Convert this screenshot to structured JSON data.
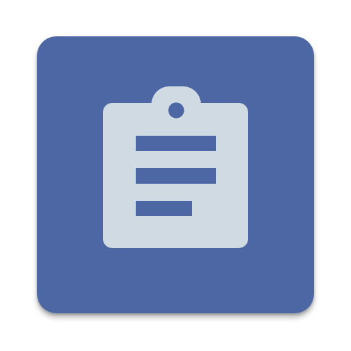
{
  "app_icon": {
    "icon_name": "clipboard-text-icon",
    "colors": {
      "background": "#4c67a3",
      "clipboard": "#cfdae2",
      "text_lines": "#4c67a3"
    }
  }
}
